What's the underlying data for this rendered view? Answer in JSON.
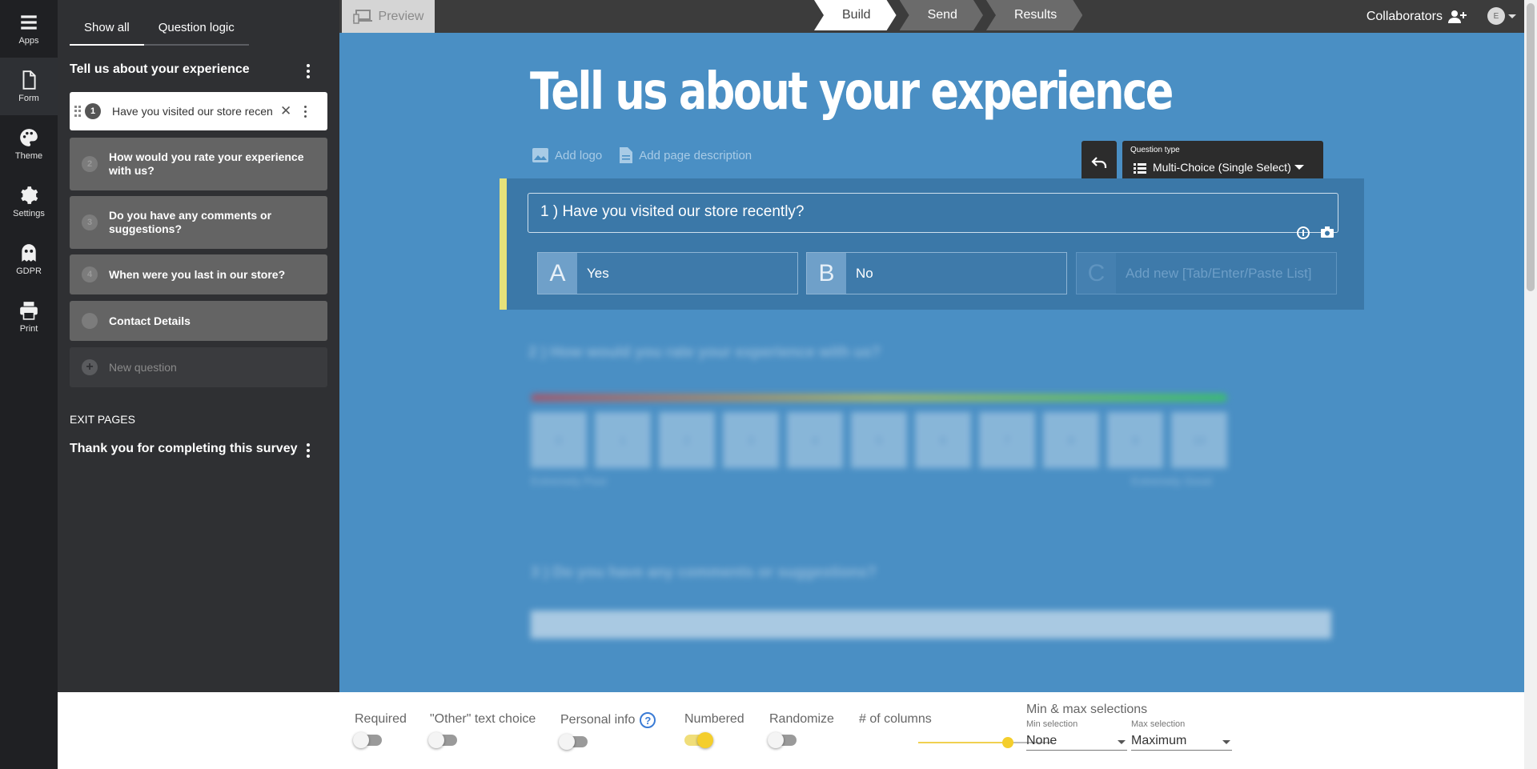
{
  "rail": [
    {
      "label": "Apps",
      "icon": "apps-grid-icon"
    },
    {
      "label": "Form",
      "icon": "document-icon"
    },
    {
      "label": "Theme",
      "icon": "palette-icon"
    },
    {
      "label": "Settings",
      "icon": "gear-icon"
    },
    {
      "label": "GDPR",
      "icon": "ghost-icon"
    },
    {
      "label": "Print",
      "icon": "printer-icon"
    }
  ],
  "sidebar": {
    "tabs": [
      "Show all",
      "Question logic"
    ],
    "page_title": "Tell us about your experience",
    "questions": [
      {
        "num": "1",
        "label": "Have you visited our store recen"
      },
      {
        "num": "2",
        "label": "How would you rate your experience with us?"
      },
      {
        "num": "3",
        "label": "Do you have any comments or suggestions?"
      },
      {
        "num": "4",
        "label": "When were you last in our store?"
      },
      {
        "num": "",
        "label": "Contact Details"
      },
      {
        "num": "+",
        "label": "New question"
      }
    ],
    "exit_label": "EXIT PAGES",
    "exit_title": "Thank you for completing this survey"
  },
  "topbar": {
    "preview": "Preview",
    "steps": [
      "Build",
      "Send",
      "Results"
    ],
    "collaborators": "Collaborators",
    "avatar": "E"
  },
  "canvas": {
    "title": "Tell us about your experience",
    "add_logo": "Add logo",
    "add_description": "Add page description",
    "question_type_label": "Question type",
    "question_type_value": "Multi-Choice (Single Select)",
    "question_text": "1 )  Have you visited our store recently?",
    "choices": [
      {
        "letter": "A",
        "text": "Yes"
      },
      {
        "letter": "B",
        "text": "No"
      },
      {
        "letter": "C",
        "text": "Add new [Tab/Enter/Paste List]"
      }
    ],
    "blurred": {
      "q2": "2 ) How would you rate your experience with us?",
      "scale": [
        "0",
        "1",
        "2",
        "3",
        "4",
        "5",
        "6",
        "7",
        "8",
        "9",
        "10"
      ],
      "low": "Extremely Poor",
      "high": "Extremely Good",
      "q3": "3 ) Do you have any comments or suggestions?"
    }
  },
  "bottombar": {
    "required": "Required",
    "other": "\"Other\" text choice",
    "personal": "Personal info",
    "help": "?",
    "numbered": "Numbered",
    "randomize": "Randomize",
    "columns": "# of columns",
    "minmax": "Min & max selections",
    "min_label": "Min selection",
    "min_value": "None",
    "max_label": "Max selection",
    "max_value": "Maximum",
    "toggles": {
      "required": false,
      "other": false,
      "personal": false,
      "numbered": true,
      "randomize": false
    }
  }
}
